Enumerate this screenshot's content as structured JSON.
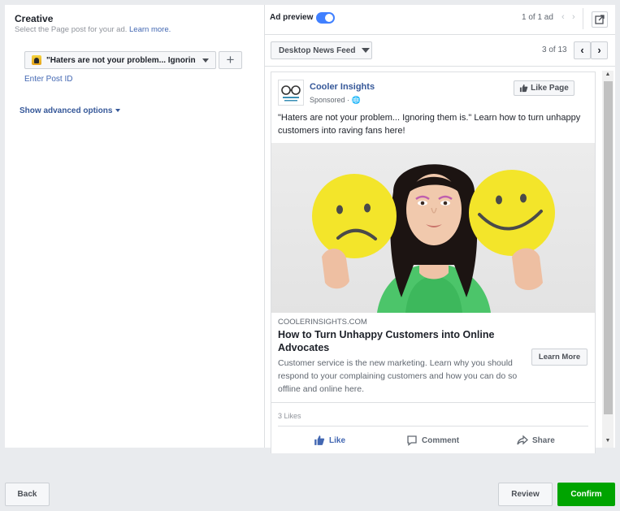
{
  "creative": {
    "title": "Creative",
    "subtitle": "Select the Page post for your ad.",
    "learn_more": "Learn more.",
    "post_select_value": "\"Haters are not your problem... Ignorin...",
    "add_symbol": "+",
    "enter_post_id": "Enter Post ID",
    "advanced_options": "Show advanced options"
  },
  "preview": {
    "label": "Ad preview",
    "toggle_on": true,
    "ad_count": "1 of 1 ad",
    "placement": "Desktop News Feed",
    "placement_count": "3 of 13"
  },
  "post": {
    "page_name": "Cooler Insights",
    "sponsored": "Sponsored",
    "like_page": "Like Page",
    "text": "\"Haters are not your problem... Ignoring them is.\" Learn how to turn unhappy customers into raving fans here!",
    "domain": "COOLERINSIGHTS.COM",
    "headline": "How to Turn Unhappy Customers into Online Advocates",
    "description": "Customer service is the new marketing. Learn why you should respond to your complaining customers and how you can do so offline and online here.",
    "cta": "Learn More",
    "likes": "3 Likes",
    "actions": {
      "like": "Like",
      "comment": "Comment",
      "share": "Share"
    }
  },
  "footer": {
    "back": "Back",
    "review": "Review",
    "confirm": "Confirm"
  },
  "colors": {
    "accent": "#4267b2",
    "confirm": "#00a400",
    "toggle": "#4080ff"
  }
}
